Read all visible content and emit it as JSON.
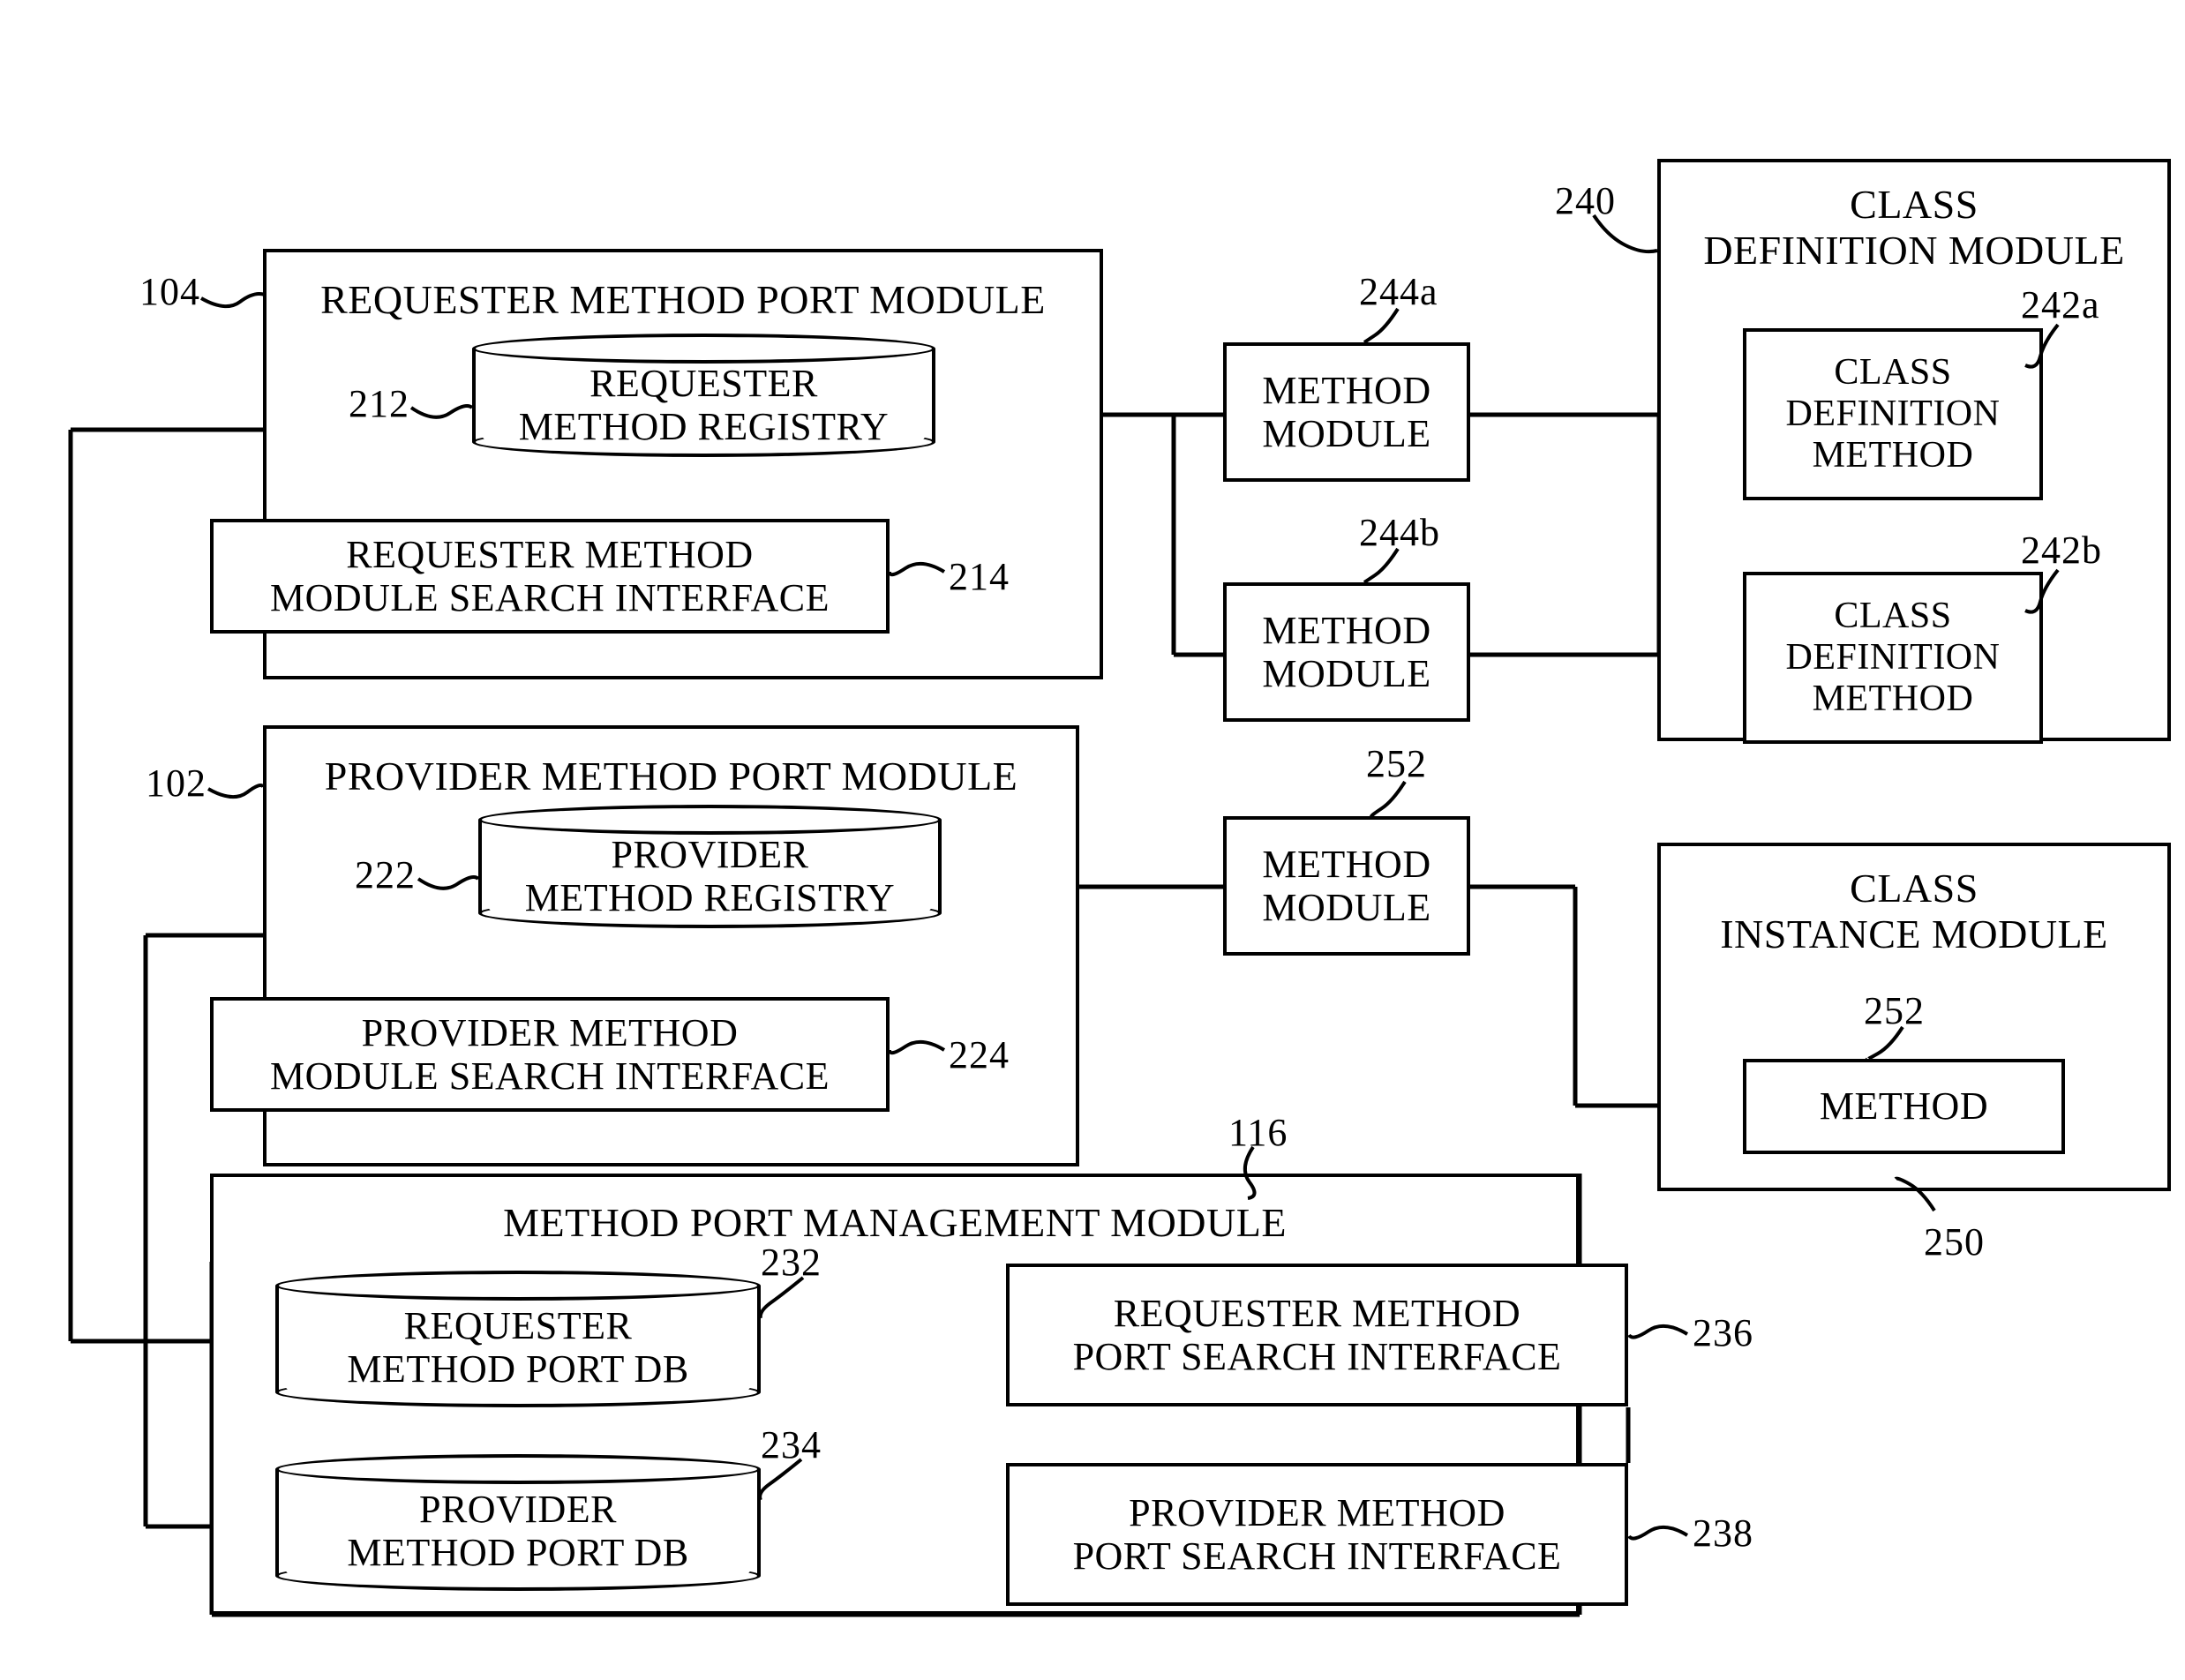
{
  "figure": {
    "title": "Method port module block diagram",
    "background_color": "#ffffff",
    "line_color": "#000000"
  },
  "modules": {
    "requester_method_port_module": {
      "label": "REQUESTER METHOD PORT MODULE",
      "ref": "104",
      "children": {
        "requester_method_registry": {
          "label": "REQUESTER\nMETHOD REGISTRY",
          "ref": "212"
        },
        "requester_method_module_search_interface": {
          "label": "REQUESTER METHOD\nMODULE SEARCH INTERFACE",
          "ref": "214"
        }
      }
    },
    "provider_method_port_module": {
      "label": "PROVIDER METHOD PORT MODULE",
      "ref": "102",
      "children": {
        "provider_method_registry": {
          "label": "PROVIDER\nMETHOD REGISTRY",
          "ref": "222"
        },
        "provider_method_module_search_interface": {
          "label": "PROVIDER METHOD\nMODULE SEARCH INTERFACE",
          "ref": "224"
        }
      }
    },
    "method_port_management_module": {
      "label": "METHOD PORT MANAGEMENT MODULE",
      "ref": "116",
      "children": {
        "requester_method_port_db": {
          "label": "REQUESTER\nMETHOD PORT DB",
          "ref": "232"
        },
        "provider_method_port_db": {
          "label": "PROVIDER\nMETHOD PORT DB",
          "ref": "234"
        },
        "requester_method_port_search_interface": {
          "label": "REQUESTER METHOD\nPORT SEARCH INTERFACE",
          "ref": "236"
        },
        "provider_method_port_search_interface": {
          "label": "PROVIDER METHOD\nPORT SEARCH INTERFACE",
          "ref": "238"
        }
      }
    },
    "class_definition_module": {
      "label": "CLASS\nDEFINITION MODULE",
      "ref": "240",
      "children": {
        "class_definition_method_a": {
          "label": "CLASS\nDEFINITION\nMETHOD",
          "ref": "242a"
        },
        "class_definition_method_b": {
          "label": "CLASS\nDEFINITION\nMETHOD",
          "ref": "242b"
        }
      }
    },
    "class_instance_module": {
      "label": "CLASS\nINSTANCE MODULE",
      "ref": "250",
      "children": {
        "method": {
          "label": "METHOD",
          "ref": "252"
        }
      }
    }
  },
  "method_modules": [
    {
      "label": "METHOD\nMODULE",
      "ref": "244a"
    },
    {
      "label": "METHOD\nMODULE",
      "ref": "244b"
    },
    {
      "label": "METHOD\nMODULE",
      "ref": "252"
    }
  ]
}
